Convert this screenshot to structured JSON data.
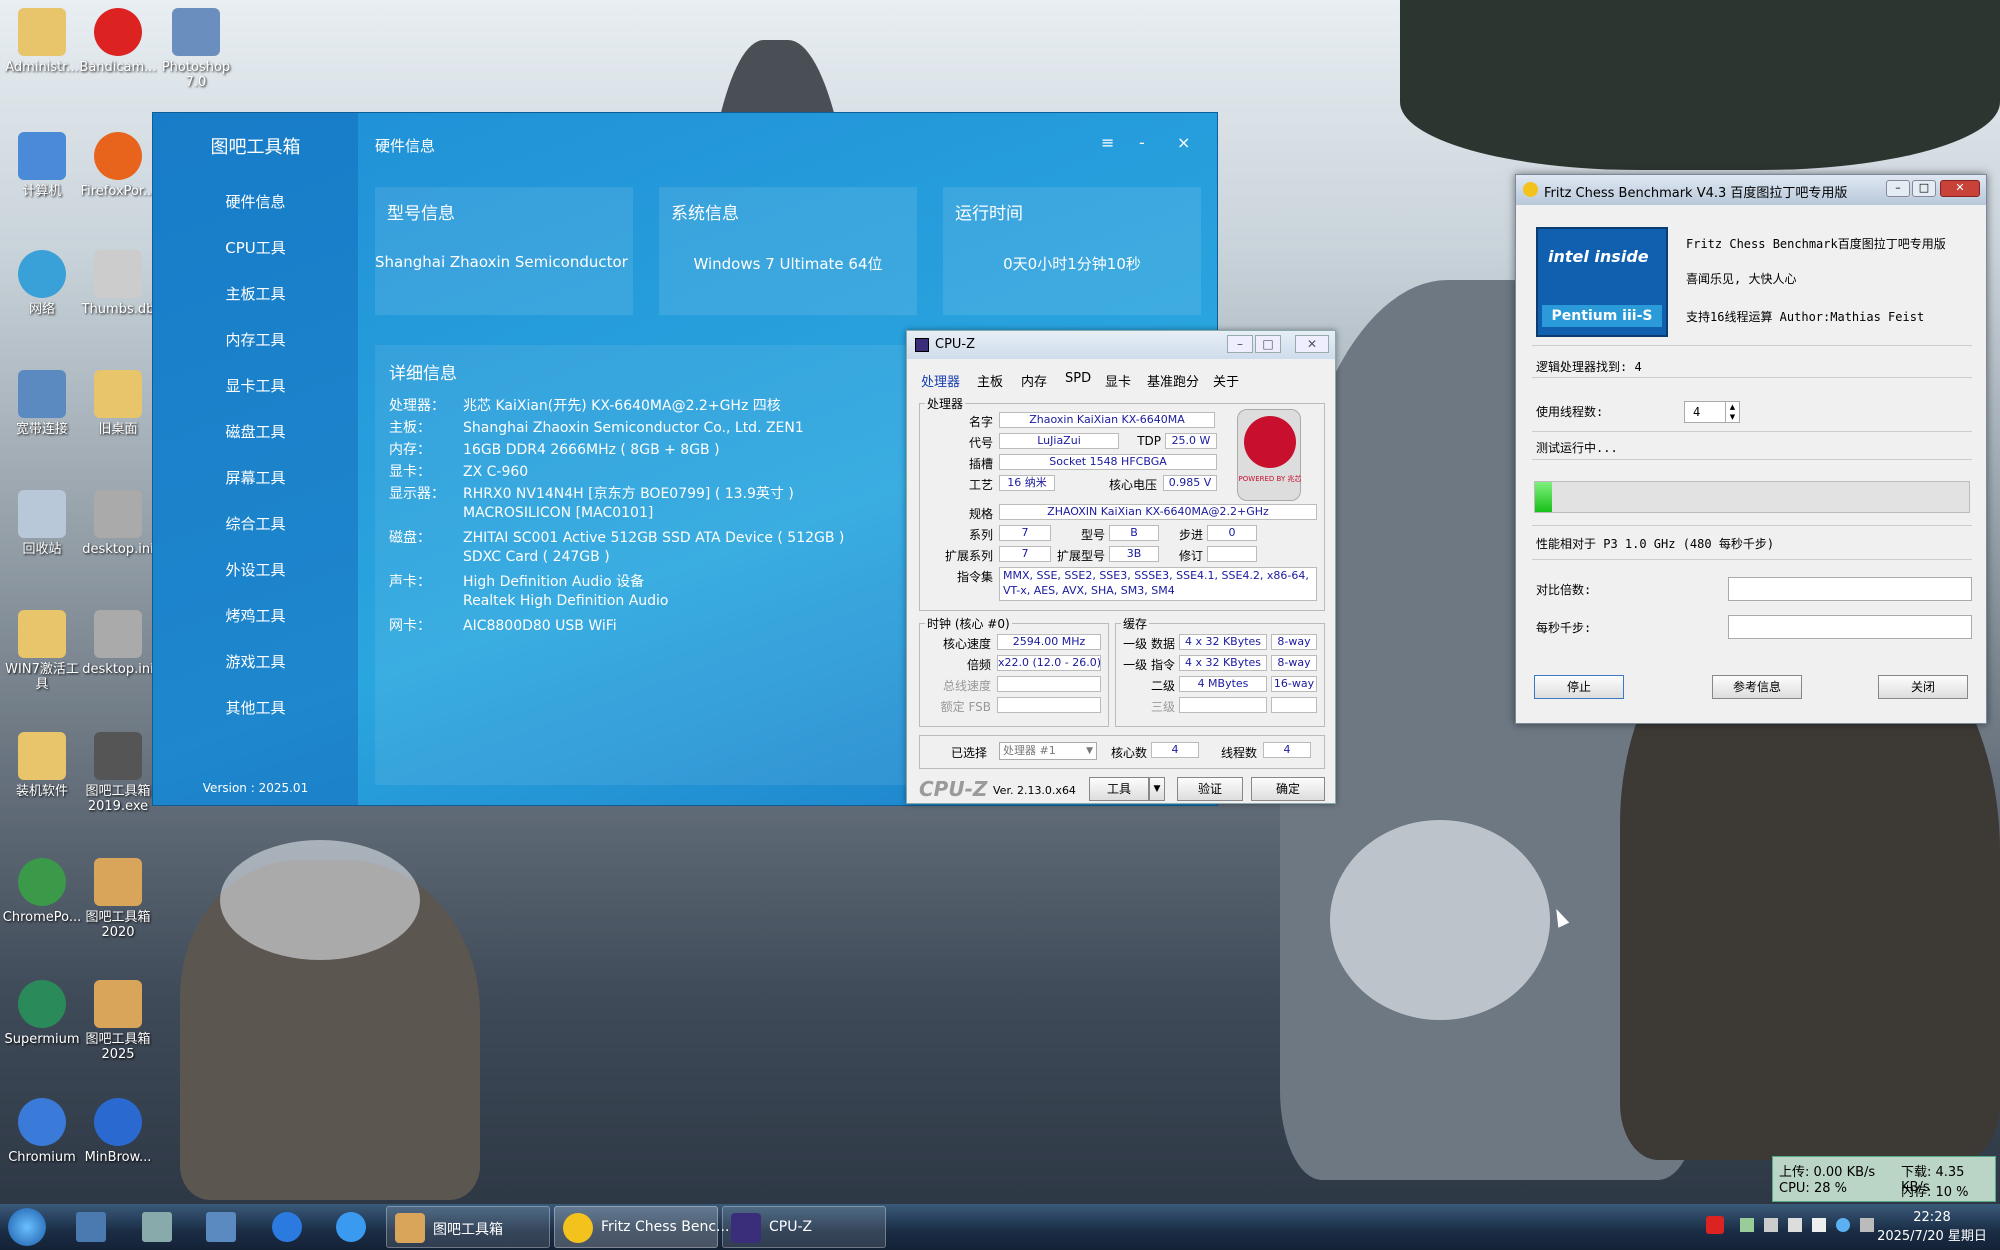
{
  "desktop": {
    "icons": [
      "Administr...",
      "Bandicam...",
      "Photoshop 7.0",
      "计算机",
      "FirefoxPor...",
      "网络",
      "Thumbs.db",
      "宽带连接",
      "旧桌面",
      "回收站",
      "desktop.ini",
      "WIN7激活工具",
      "desktop.ini",
      "装机软件",
      "图吧工具箱2019.exe",
      "ChromePo...",
      "图吧工具箱2020",
      "Supermium",
      "图吧工具箱2025",
      "Chromium",
      "MinBrow..."
    ]
  },
  "toolbox": {
    "title": "图吧工具箱",
    "menu": [
      "硬件信息",
      "CPU工具",
      "主板工具",
      "内存工具",
      "显卡工具",
      "磁盘工具",
      "屏幕工具",
      "综合工具",
      "外设工具",
      "烤鸡工具",
      "游戏工具",
      "其他工具"
    ],
    "version": "Version : 2025.01",
    "header": "硬件信息",
    "window_buttons": [
      "≡",
      "-",
      "×"
    ],
    "cards": [
      {
        "title": "型号信息",
        "value": "Shanghai Zhaoxin Semiconductor Co., L"
      },
      {
        "title": "系统信息",
        "value": "Windows 7 Ultimate 64位"
      },
      {
        "title": "运行时间",
        "value": "0天0小时1分钟10秒"
      }
    ],
    "detail_title": "详细信息",
    "details": [
      {
        "k": "处理器：",
        "v": "兆芯 KaiXian(开先) KX-6640MA@2.2+GHz 四核"
      },
      {
        "k": "主板：",
        "v": "Shanghai Zhaoxin Semiconductor Co., Ltd. ZEN1"
      },
      {
        "k": "内存：",
        "v": "16GB DDR4 2666MHz ( 8GB + 8GB )"
      },
      {
        "k": "显卡：",
        "v": "ZX C-960"
      },
      {
        "k": "显示器：",
        "v": "RHRX0 NV14N4H [京东方 BOE0799] ( 13.9英寸 )"
      },
      {
        "k": "",
        "v": "MACROSILICON [MAC0101]"
      },
      {
        "k": "磁盘：",
        "v": "ZHITAI SC001 Active 512GB SSD ATA Device ( 512GB )"
      },
      {
        "k": "",
        "v": "SDXC Card ( 247GB )"
      },
      {
        "k": "声卡：",
        "v": "High Definition Audio 设备"
      },
      {
        "k": "",
        "v": "Realtek High Definition Audio"
      },
      {
        "k": "网卡：",
        "v": "AIC8800D80 USB WiFi"
      }
    ]
  },
  "cpuz": {
    "title": "CPU-Z",
    "tabs": [
      "处理器",
      "主板",
      "内存",
      "SPD",
      "显卡",
      "基准跑分",
      "关于"
    ],
    "group_processor": "处理器",
    "labels": {
      "name": "名字",
      "codename": "代号",
      "tdp": "TDP",
      "socket": "插槽",
      "process": "工艺",
      "vcore": "核心电压",
      "spec": "规格",
      "family": "系列",
      "model": "型号",
      "stepping": "步进",
      "extfamily": "扩展系列",
      "extmodel": "扩展型号",
      "revision": "修订",
      "instr": "指令集"
    },
    "values": {
      "name": "Zhaoxin KaiXian KX-6640MA",
      "codename": "LuJiaZui",
      "tdp": "25.0 W",
      "socket": "Socket 1548 HFCBGA",
      "process": "16 纳米",
      "vcore": "0.985 V",
      "spec": "ZHAOXIN KaiXian KX-6640MA@2.2+GHz",
      "family": "7",
      "model": "B",
      "stepping": "0",
      "extfamily": "7",
      "extmodel": "3B",
      "revision": "",
      "instr1": "MMX, SSE, SSE2, SSE3, SSSE3, SSE4.1, SSE4.2, x86-64,",
      "instr2": "VT-x, AES, AVX, SHA, SM3, SM4"
    },
    "logo_text": "POWERED BY 兆芯",
    "clock_group": "时钟 (核心 #0)",
    "clock_labels": [
      "核心速度",
      "倍频",
      "总线速度",
      "额定 FSB"
    ],
    "clock_values": [
      "2594.00 MHz",
      "x22.0 (12.0 - 26.0)",
      "",
      ""
    ],
    "cache_group": "缓存",
    "cache_labels": [
      "一级 数据",
      "一级 指令",
      "二级",
      "三级"
    ],
    "cache_values": [
      [
        "4 x 32 KBytes",
        "8-way"
      ],
      [
        "4 x 32 KBytes",
        "8-way"
      ],
      [
        "4 MBytes",
        "16-way"
      ],
      [
        "",
        ""
      ]
    ],
    "selected_label": "已选择",
    "selected_value": "处理器 #1",
    "cores_label": "核心数",
    "cores": "4",
    "threads_label": "线程数",
    "threads": "4",
    "brand": "CPU-Z",
    "version": "Ver. 2.13.0.x64",
    "btn_tools": "工具",
    "btn_validate": "验证",
    "btn_ok": "确定"
  },
  "fritz": {
    "title": "Fritz Chess Benchmark V4.3  百度图拉丁吧专用版",
    "logo_top": "intel inside",
    "logo_bottom": "Pentium iii-S",
    "line1": "Fritz Chess Benchmark百度图拉丁吧专用版",
    "line2": "喜闻乐见, 大快人心",
    "line3": "支持16线程运算   Author:Mathias Feist",
    "found_label": "逻辑处理器找到: 4",
    "threads_label": "使用线程数:",
    "threads_value": "4",
    "status": "测试运行中...",
    "progress": 0.04,
    "relative": "性能相对于 P3 1.0 GHz (480 每秒千步)",
    "ratio_label": "对比倍数:",
    "kps_label": "每秒千步:",
    "btn_stop": "停止",
    "btn_info": "参考信息",
    "btn_close": "关闭"
  },
  "taskbar": {
    "apps": [
      "图吧工具箱",
      "Fritz Chess Benc...",
      "CPU-Z"
    ],
    "time": "22:28",
    "date": "2025/7/20 星期日"
  },
  "netmon": {
    "up": "上传: 0.00 KB/s",
    "down": "下载: 4.35 KB/s",
    "cpu": "CPU: 28 %",
    "mem": "内存: 10 %"
  }
}
